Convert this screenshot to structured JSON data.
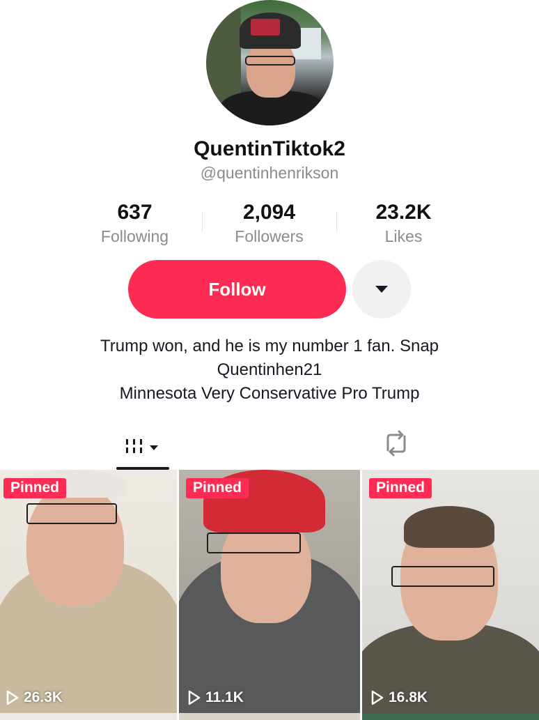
{
  "profile": {
    "display_name": "QuentinTiktok2",
    "handle": "@quentinhenrikson",
    "avatar_icon": "profile-photo"
  },
  "stats": [
    {
      "value": "637",
      "label": "Following"
    },
    {
      "value": "2,094",
      "label": "Followers"
    },
    {
      "value": "23.2K",
      "label": "Likes"
    }
  ],
  "actions": {
    "follow_label": "Follow",
    "more_icon": "caret-down-icon"
  },
  "bio": {
    "lines": [
      "Trump won, and he  is my number 1 fan. Snap",
      "Quentinhen21",
      "Minnesota Very Conservative Pro Trump"
    ]
  },
  "tabs": {
    "videos_icon": "video-grid-icon",
    "reposts_icon": "repost-icon"
  },
  "videos": [
    {
      "badge": "Pinned",
      "views": "26.3K"
    },
    {
      "badge": "Pinned",
      "views": "11.1K"
    },
    {
      "badge": "Pinned",
      "views": "16.8K"
    }
  ],
  "colors": {
    "accent": "#fe2c55",
    "secondary_text": "#8a8b91"
  }
}
